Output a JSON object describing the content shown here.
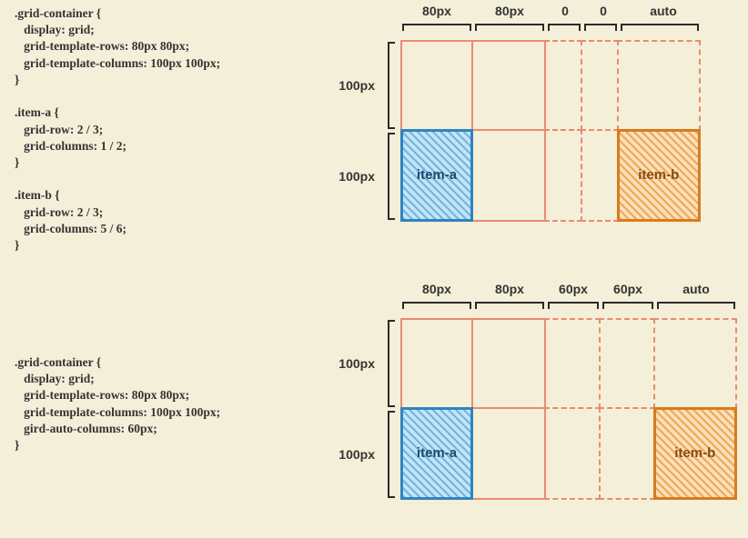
{
  "code1": ".grid-container {\n   display: grid;\n   grid-template-rows: 80px 80px;\n   grid-template-columns: 100px 100px;\n}\n\n.item-a {\n   grid-row: 2 / 3;\n   grid-columns: 1 / 2;\n}\n\n.item-b {\n   grid-row: 2 / 3;\n   grid-columns: 5 / 6;\n}",
  "code2": ".grid-container {\n   display: grid;\n   grid-template-rows: 80px 80px;\n   grid-template-columns: 100px 100px;\n   gird-auto-columns: 60px;\n}",
  "diagram1": {
    "cols": [
      "80px",
      "80px",
      "0",
      "0",
      "auto"
    ],
    "rows": [
      "100px",
      "100px"
    ],
    "itemA": "item-a",
    "itemB": "item-b"
  },
  "diagram2": {
    "cols": [
      "80px",
      "80px",
      "60px",
      "60px",
      "auto"
    ],
    "rows": [
      "100px",
      "100px"
    ],
    "itemA": "item-a",
    "itemB": "item-b"
  }
}
